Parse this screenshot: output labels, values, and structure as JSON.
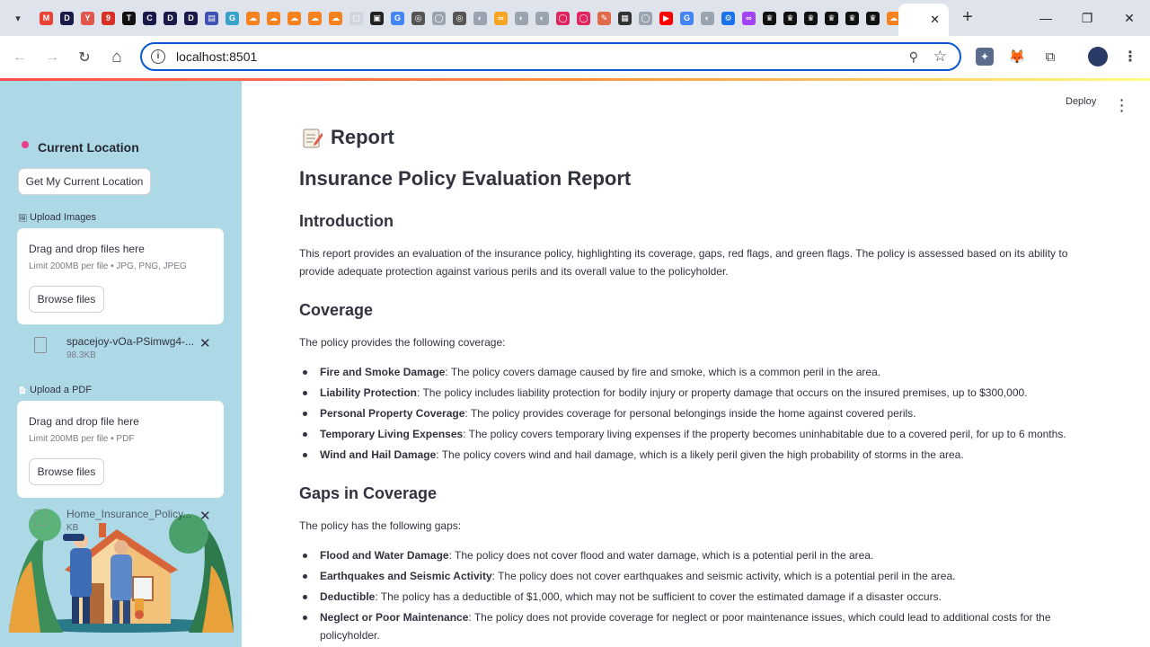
{
  "browser": {
    "url": "localhost:8501",
    "favicons": [
      {
        "glyph": "M",
        "color": "#ea4335"
      },
      {
        "glyph": "D",
        "color": "#1a1a4a"
      },
      {
        "glyph": "Y",
        "color": "#e2574c"
      },
      {
        "glyph": "9",
        "color": "#d93025"
      },
      {
        "glyph": "T",
        "color": "#111111"
      },
      {
        "glyph": "C",
        "color": "#1a1a4a"
      },
      {
        "glyph": "D",
        "color": "#1a1a4a"
      },
      {
        "glyph": "D",
        "color": "#1a1a4a"
      },
      {
        "glyph": "▤",
        "color": "#3f51b5"
      },
      {
        "glyph": "G",
        "color": "#3aa1c9"
      },
      {
        "glyph": "☁",
        "color": "#f6821f"
      },
      {
        "glyph": "☁",
        "color": "#f6821f"
      },
      {
        "glyph": "☁",
        "color": "#f6821f"
      },
      {
        "glyph": "☁",
        "color": "#f6821f"
      },
      {
        "glyph": "☁",
        "color": "#f6821f"
      },
      {
        "glyph": "▢",
        "color": "#cfd6e0"
      },
      {
        "glyph": "▣",
        "color": "#222222"
      },
      {
        "glyph": "G",
        "color": "#4285f4"
      },
      {
        "glyph": "◎",
        "color": "#555555"
      },
      {
        "glyph": "◯",
        "color": "#9aa4b1"
      },
      {
        "glyph": "◎",
        "color": "#555555"
      },
      {
        "glyph": "◐",
        "color": "#9aa4b1"
      },
      {
        "glyph": "∞",
        "color": "#f5a623"
      },
      {
        "glyph": "◐",
        "color": "#9aa4b1"
      },
      {
        "glyph": "◐",
        "color": "#9aa4b1"
      },
      {
        "glyph": "◯",
        "color": "#e0245e"
      },
      {
        "glyph": "◯",
        "color": "#e0245e"
      },
      {
        "glyph": "✎",
        "color": "#e06c4c"
      },
      {
        "glyph": "▦",
        "color": "#333333"
      },
      {
        "glyph": "◯",
        "color": "#9aa4b1"
      },
      {
        "glyph": "▶",
        "color": "#ff0000"
      },
      {
        "glyph": "G",
        "color": "#4285f4"
      },
      {
        "glyph": "◐",
        "color": "#9aa4b1"
      },
      {
        "glyph": "⚙",
        "color": "#1a73e8"
      },
      {
        "glyph": "∞",
        "color": "#a142f4"
      },
      {
        "glyph": "♛",
        "color": "#111111"
      },
      {
        "glyph": "♛",
        "color": "#111111"
      },
      {
        "glyph": "♛",
        "color": "#111111"
      },
      {
        "glyph": "♛",
        "color": "#111111"
      },
      {
        "glyph": "♛",
        "color": "#111111"
      },
      {
        "glyph": "♛",
        "color": "#111111"
      },
      {
        "glyph": "☁",
        "color": "#f6821f"
      },
      {
        "glyph": "▢",
        "color": "#cfd6e0"
      }
    ],
    "tab_close": "✕",
    "new_tab": "+",
    "win_min": "—",
    "win_restore": "❐",
    "win_close": "✕",
    "back": "←",
    "forward": "→",
    "reload": "↻",
    "home": "⌂",
    "zoom": "⚲",
    "star": "☆",
    "info": "i",
    "extensions": [
      {
        "name": "puzzle-extension-icon",
        "glyph": "✦",
        "color": "#5b6b8c"
      },
      {
        "name": "metamask-icon",
        "glyph": "🦊",
        "color": "#f6851b"
      },
      {
        "name": "extensions-icon",
        "glyph": "⧉",
        "color": "#444444"
      }
    ],
    "menu": "⋮"
  },
  "sidebar": {
    "location_heading": "Current Location",
    "location_button": "Get My Current Location",
    "upload_images_label": "Upload Images",
    "images_dropzone": {
      "title": "Drag and drop files here",
      "limit": "Limit 200MB per file • JPG, PNG, JPEG",
      "browse": "Browse files"
    },
    "image_file": {
      "name": "spacejoy-vOa-PSimwg4-...",
      "size": "98.3KB"
    },
    "upload_pdf_label": "Upload a PDF",
    "pdf_dropzone": {
      "title": "Drag and drop file here",
      "limit": "Limit 200MB per file • PDF",
      "browse": "Browse files"
    },
    "pdf_file": {
      "name": "Home_Insurance_Policy...",
      "size": "KB"
    }
  },
  "header": {
    "deploy": "Deploy"
  },
  "main": {
    "page_title": "Report",
    "report_title": "Insurance Policy Evaluation Report",
    "introduction": {
      "heading": "Introduction",
      "text": "This report provides an evaluation of the insurance policy, highlighting its coverage, gaps, red flags, and green flags. The policy is assessed based on its ability to provide adequate protection against various perils and its overall value to the policyholder."
    },
    "coverage": {
      "heading": "Coverage",
      "lead": "The policy provides the following coverage:",
      "items": [
        {
          "term": "Fire and Smoke Damage",
          "text": ": The policy covers damage caused by fire and smoke, which is a common peril in the area."
        },
        {
          "term": "Liability Protection",
          "text": ": The policy includes liability protection for bodily injury or property damage that occurs on the insured premises, up to $300,000."
        },
        {
          "term": "Personal Property Coverage",
          "text": ": The policy provides coverage for personal belongings inside the home against covered perils."
        },
        {
          "term": "Temporary Living Expenses",
          "text": ": The policy covers temporary living expenses if the property becomes uninhabitable due to a covered peril, for up to 6 months."
        },
        {
          "term": "Wind and Hail Damage",
          "text": ": The policy covers wind and hail damage, which is a likely peril given the high probability of storms in the area."
        }
      ]
    },
    "gaps": {
      "heading": "Gaps in Coverage",
      "lead": "The policy has the following gaps:",
      "items": [
        {
          "term": "Flood and Water Damage",
          "text": ": The policy does not cover flood and water damage, which is a potential peril in the area."
        },
        {
          "term": "Earthquakes and Seismic Activity",
          "text": ": The policy does not cover earthquakes and seismic activity, which is a potential peril in the area."
        },
        {
          "term": "Deductible",
          "text": ": The policy has a deductible of $1,000, which may not be sufficient to cover the estimated damage if a disaster occurs."
        },
        {
          "term": "Neglect or Poor Maintenance",
          "text": ": The policy does not provide coverage for neglect or poor maintenance issues, which could lead to additional costs for the policyholder."
        }
      ]
    }
  }
}
